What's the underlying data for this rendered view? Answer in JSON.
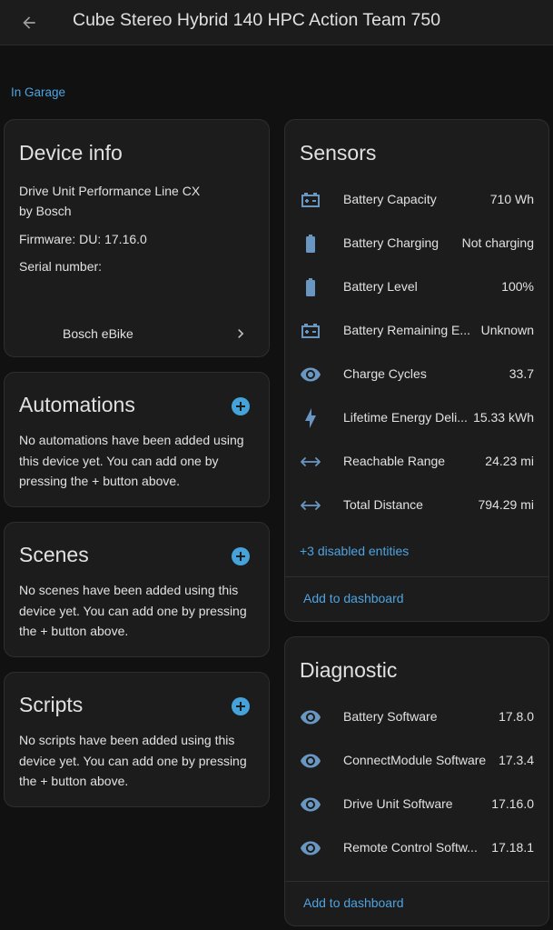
{
  "header": {
    "title": "Cube Stereo Hybrid 140 HPC Action Team 750",
    "back_icon": "arrow-left-icon"
  },
  "area": {
    "label": "In Garage"
  },
  "device_info": {
    "title": "Device info",
    "model": "Drive Unit Performance Line CX",
    "manufacturer": "by Bosch",
    "firmware": "Firmware: DU: 17.16.0",
    "serial": "Serial number:",
    "integration": "Bosch eBike"
  },
  "automations": {
    "title": "Automations",
    "text": "No automations have been added using this device yet. You can add one by pressing the + button above."
  },
  "scenes": {
    "title": "Scenes",
    "text": "No scenes have been added using this device yet. You can add one by pressing the + button above."
  },
  "scripts": {
    "title": "Scripts",
    "text": "No scripts have been added using this device yet. You can add one by pressing the + button above."
  },
  "sensors": {
    "title": "Sensors",
    "items": [
      {
        "icon": "battery-charging-icon",
        "name": "Battery Capacity",
        "value": "710 Wh"
      },
      {
        "icon": "battery-icon",
        "name": "Battery Charging",
        "value": "Not charging"
      },
      {
        "icon": "battery-icon",
        "name": "Battery Level",
        "value": "100%"
      },
      {
        "icon": "battery-charging-icon",
        "name": "Battery Remaining E...",
        "value": "Unknown"
      },
      {
        "icon": "eye-icon",
        "name": "Charge Cycles",
        "value": "33.7"
      },
      {
        "icon": "lightning-icon",
        "name": "Lifetime Energy Deli...",
        "value": "15.33 kWh"
      },
      {
        "icon": "arrow-left-right-icon",
        "name": "Reachable Range",
        "value": "24.23 mi"
      },
      {
        "icon": "arrow-left-right-icon",
        "name": "Total Distance",
        "value": "794.29 mi"
      }
    ],
    "disabled": "+3 disabled entities",
    "add_label": "Add to dashboard"
  },
  "diagnostic": {
    "title": "Diagnostic",
    "items": [
      {
        "icon": "eye-icon",
        "name": "Battery Software",
        "value": "17.8.0"
      },
      {
        "icon": "eye-icon",
        "name": "ConnectModule Software",
        "value": "17.3.4"
      },
      {
        "icon": "eye-icon",
        "name": "Drive Unit Software",
        "value": "17.16.0"
      },
      {
        "icon": "eye-icon",
        "name": "Remote Control Softw...",
        "value": "17.18.1"
      }
    ],
    "add_label": "Add to dashboard"
  },
  "colors": {
    "background": "#111111",
    "card": "#1c1c1c",
    "accent": "#45a3d9",
    "link": "#4ea3e0",
    "icon": "#6a97c2"
  }
}
